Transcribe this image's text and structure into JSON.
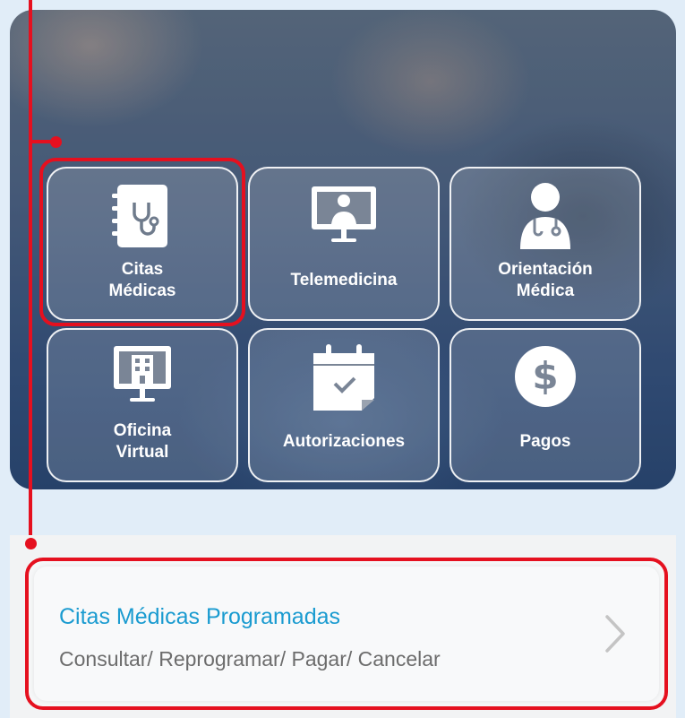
{
  "menu": {
    "tiles": [
      {
        "id": "citas",
        "label": "Citas\nMédicas",
        "icon": "medical-notebook-stethoscope-icon"
      },
      {
        "id": "telemedicina",
        "label": "Telemedicina",
        "icon": "doctor-monitor-icon"
      },
      {
        "id": "orientacion",
        "label": "Orientación\nMédica",
        "icon": "doctor-icon"
      },
      {
        "id": "oficina",
        "label": "Oficina\nVirtual",
        "icon": "building-monitor-icon"
      },
      {
        "id": "autorizaciones",
        "label": "Autorizaciones",
        "icon": "calendar-check-icon"
      },
      {
        "id": "pagos",
        "label": "Pagos",
        "icon": "dollar-circle-icon"
      }
    ]
  },
  "appointments_card": {
    "title": "Citas Médicas Programadas",
    "subtitle": "Consultar/ Reprogramar/ Pagar/ Cancelar",
    "chevron_icon": "chevron-right-icon"
  },
  "colors": {
    "highlight": "#e5101f",
    "title_blue": "#1a9bd0",
    "background": "#e1edf8"
  }
}
